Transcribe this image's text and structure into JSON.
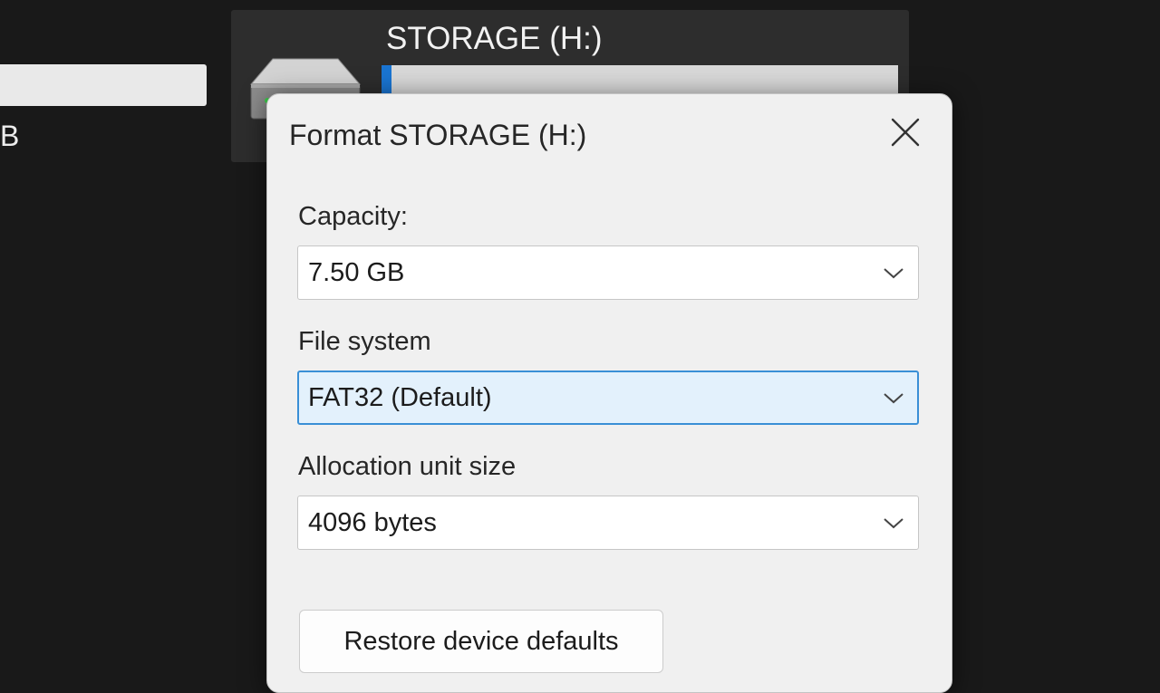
{
  "background": {
    "partial_size_text": "B",
    "drive": {
      "name": "STORAGE (H:)",
      "icon": "hard-drive-icon",
      "used_fraction": 0.02
    }
  },
  "dialog": {
    "title": "Format STORAGE (H:)",
    "close_icon": "close-icon",
    "capacity": {
      "label": "Capacity:",
      "value": "7.50 GB"
    },
    "file_system": {
      "label": "File system",
      "value": "FAT32 (Default)"
    },
    "allocation_unit_size": {
      "label": "Allocation unit size",
      "value": "4096 bytes"
    },
    "restore_defaults_label": "Restore device defaults"
  },
  "colors": {
    "accent": "#1a75d2",
    "focus_border": "#3a8fd6",
    "focus_fill": "#e3f1fc",
    "dialog_bg": "#f0f0f0",
    "desktop_bg": "#191919"
  }
}
